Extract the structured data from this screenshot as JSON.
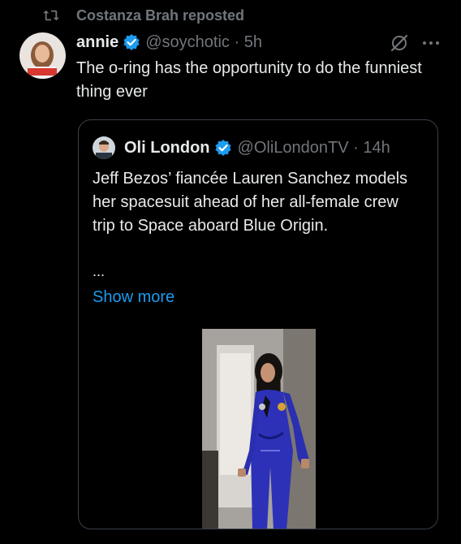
{
  "repost": {
    "text": "Costanza Brah reposted",
    "icon": "repost-icon"
  },
  "post": {
    "display_name": "annie",
    "handle": "@soychotic",
    "time": "5h",
    "text": "The o-ring has the opportunity to do the funniest thing ever",
    "verified": true,
    "icons": [
      "grok-icon",
      "more-icon"
    ]
  },
  "quote": {
    "display_name": "Oli London",
    "handle": "@OliLondonTV",
    "time": "14h",
    "verified": true,
    "text": "Jeff Bezos’ fiancée Lauren Sanchez models her spacesuit ahead of her all-female crew trip to Space aboard Blue Origin.",
    "ellipsis": "...",
    "show_more": "Show more"
  },
  "colors": {
    "background": "#000000",
    "primary_text": "#e7e9ea",
    "secondary_text": "#71767b",
    "accent_blue": "#1d9bf0",
    "card_border": "#38404a"
  }
}
